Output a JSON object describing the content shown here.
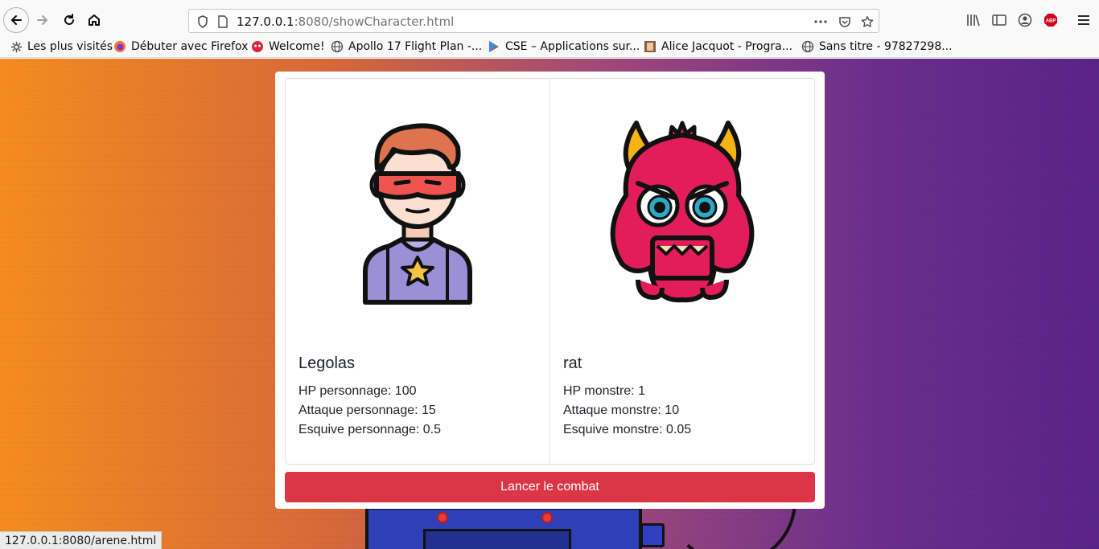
{
  "browser": {
    "url_host": "127.0.0.1",
    "url_rest": ":8080/showCharacter.html",
    "bookmarks": [
      {
        "label": "Les plus visités",
        "icon": "gear-icon"
      },
      {
        "label": "Débuter avec Firefox",
        "icon": "firefox-icon"
      },
      {
        "label": "Welcome!",
        "icon": "welcome-icon"
      },
      {
        "label": "Apollo 17 Flight Plan -...",
        "icon": "globe-icon"
      },
      {
        "label": "CSE – Applications sur...",
        "icon": "play-store-icon"
      },
      {
        "label": "Alice Jacquot - Progra...",
        "icon": "image-icon"
      },
      {
        "label": "Sans titre - 97827298...",
        "icon": "globe-icon"
      }
    ],
    "status_url": "127.0.0.1:8080/arene.html"
  },
  "character": {
    "name": "Legolas",
    "hp": "HP personnage: 100",
    "attack": "Attaque personnage: 15",
    "dodge": "Esquive personnage: 0.5"
  },
  "monster": {
    "name": "rat",
    "hp": "HP monstre: 1",
    "attack": "Attaque monstre: 10",
    "dodge": "Esquive monstre: 0.05"
  },
  "actions": {
    "fight_label": "Lancer le combat"
  },
  "colors": {
    "fight_button": "#dc3545",
    "bg_left": "#f78d1f",
    "bg_right": "#5a2488"
  }
}
